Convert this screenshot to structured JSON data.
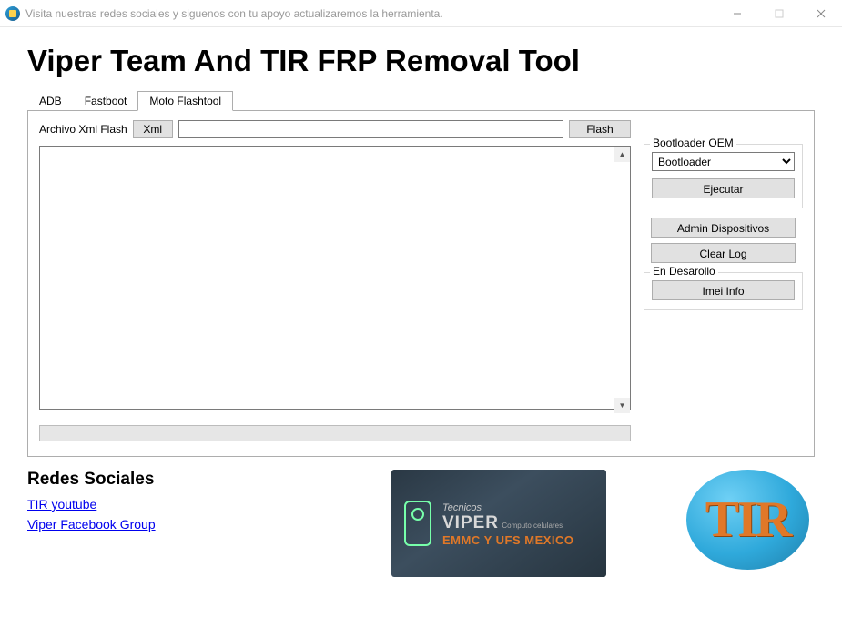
{
  "window": {
    "title": "Visita nuestras redes sociales y siguenos con tu apoyo actualizaremos la herramienta."
  },
  "header": {
    "app_title": "Viper Team And TIR FRP Removal Tool"
  },
  "tabs": {
    "items": [
      {
        "label": "ADB",
        "active": false
      },
      {
        "label": "Fastboot",
        "active": false
      },
      {
        "label": "Moto Flashtool",
        "active": true
      }
    ]
  },
  "flash_panel": {
    "archive_label": "Archivo Xml Flash",
    "xml_button": "Xml",
    "path_value": "",
    "flash_button": "Flash",
    "log_value": ""
  },
  "bootloader_box": {
    "legend": "Bootloader OEM",
    "selected": "Bootloader",
    "ejecutar": "Ejecutar"
  },
  "side": {
    "admin": "Admin Dispositivos",
    "clear": "Clear Log",
    "dev_legend": "En Desarollo",
    "imei": "Imei Info"
  },
  "social": {
    "heading": "Redes Sociales",
    "links": [
      {
        "label": "TIR youtube"
      },
      {
        "label": "Viper Facebook Group"
      }
    ]
  },
  "banner": {
    "line1": "Tecnicos",
    "viper": "VIPER",
    "sub": "Computo celulares",
    "emm": "EMMC Y UFS MEXICO"
  },
  "logo": {
    "text": "TIR"
  }
}
